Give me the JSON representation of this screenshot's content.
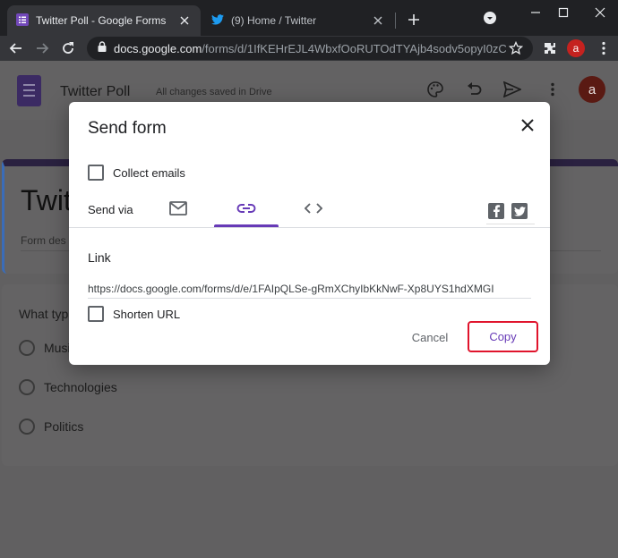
{
  "browser": {
    "tabs": [
      {
        "title": "Twitter Poll - Google Forms",
        "icon": "google-forms-icon",
        "active": true
      },
      {
        "title": "(9) Home / Twitter",
        "icon": "twitter-icon",
        "active": false
      }
    ],
    "url_host": "docs.google.com",
    "url_path": "/forms/d/1IfKEHrEJL4WbxfOoRUTOdTYAjb4sodv5opyI0zCl...",
    "profile_initial": "a"
  },
  "form": {
    "header_title": "Twitter Poll",
    "save_status": "All changes saved in Drive",
    "title_partial": "Twit",
    "description_partial": "Form des",
    "question_partial": "What typ",
    "options": [
      "Musi",
      "Technologies",
      "Politics"
    ],
    "avatar_initial": "a"
  },
  "dialog": {
    "title": "Send form",
    "collect_emails_label": "Collect emails",
    "send_via_label": "Send via",
    "send_via_tabs": [
      "email-icon",
      "link-icon",
      "embed-icon"
    ],
    "active_tab": "link-icon",
    "social": [
      "facebook-icon",
      "twitter-icon"
    ],
    "link_label": "Link",
    "link_url": "https://docs.google.com/forms/d/e/1FAIpQLSe-gRmXChyIbKkNwF-Xp8UYS1hdXMGI",
    "shorten_url_label": "Shorten URL",
    "cancel_label": "Cancel",
    "copy_label": "Copy"
  },
  "colors": {
    "accent": "#673ab7",
    "highlight": "#e0142c"
  }
}
